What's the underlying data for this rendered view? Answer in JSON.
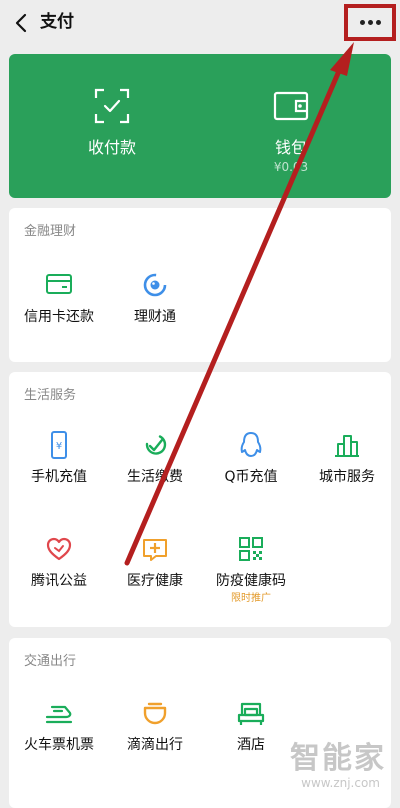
{
  "header": {
    "title": "支付"
  },
  "hero": {
    "collect_pay": {
      "label": "收付款"
    },
    "wallet": {
      "label": "钱包",
      "balance": "¥0.03"
    }
  },
  "finance": {
    "title": "金融理财",
    "items": [
      {
        "label": "信用卡还款",
        "icon": "credit-card-icon"
      },
      {
        "label": "理财通",
        "icon": "licaitong-icon"
      }
    ]
  },
  "life": {
    "title": "生活服务",
    "items": [
      {
        "label": "手机充值",
        "icon": "phone-icon"
      },
      {
        "label": "生活缴费",
        "icon": "utility-bill-icon"
      },
      {
        "label": "Q币充值",
        "icon": "qq-penguin-icon"
      },
      {
        "label": "城市服务",
        "icon": "city-buildings-icon"
      },
      {
        "label": "腾讯公益",
        "icon": "charity-heart-icon"
      },
      {
        "label": "医疗健康",
        "icon": "medical-icon"
      },
      {
        "label": "防疫健康码",
        "icon": "qr-code-icon",
        "tag": "限时推广"
      }
    ]
  },
  "transport": {
    "title": "交通出行",
    "items": [
      {
        "label": "火车票机票",
        "icon": "train-icon"
      },
      {
        "label": "滴滴出行",
        "icon": "didi-icon"
      },
      {
        "label": "酒店",
        "icon": "hotel-bed-icon"
      }
    ]
  },
  "watermark": {
    "text": "智能家",
    "url": "www.znj.com"
  },
  "colors": {
    "brand_green": "#2aa05a",
    "icon_green": "#1aad5a",
    "icon_blue": "#3e8fe8",
    "icon_orange": "#f0a02c",
    "icon_red": "#e0474c",
    "annotation_red": "#b41f1f",
    "tag_orange": "#e39a2b"
  }
}
